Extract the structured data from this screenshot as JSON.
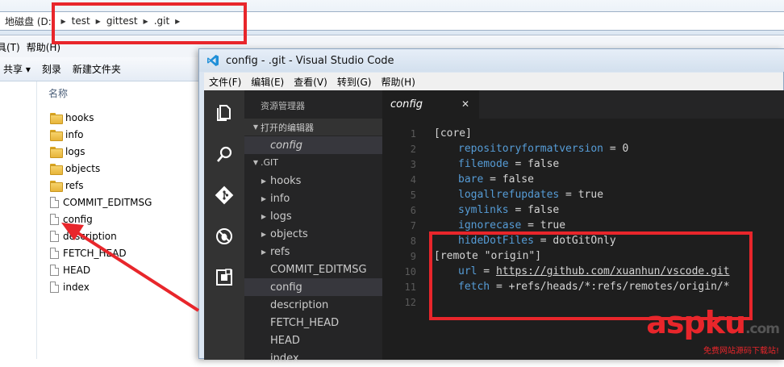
{
  "explorer": {
    "breadcrumb": [
      "地磁盘 (D:)",
      "test",
      "gittest",
      ".git"
    ],
    "menu": [
      "具(T)",
      "帮助(H)"
    ],
    "toolbar": [
      "共享 ▾",
      "刻录",
      "新建文件夹"
    ],
    "column_header": "名称",
    "items": [
      {
        "name": "hooks",
        "type": "folder"
      },
      {
        "name": "info",
        "type": "folder"
      },
      {
        "name": "logs",
        "type": "folder"
      },
      {
        "name": "objects",
        "type": "folder"
      },
      {
        "name": "refs",
        "type": "folder"
      },
      {
        "name": "COMMIT_EDITMSG",
        "type": "file"
      },
      {
        "name": "config",
        "type": "file"
      },
      {
        "name": "description",
        "type": "file"
      },
      {
        "name": "FETCH_HEAD",
        "type": "file"
      },
      {
        "name": "HEAD",
        "type": "file"
      },
      {
        "name": "index",
        "type": "file"
      }
    ]
  },
  "vscode": {
    "title": "config - .git - Visual Studio Code",
    "menu": [
      "文件(F)",
      "编辑(E)",
      "查看(V)",
      "转到(G)",
      "帮助(H)"
    ],
    "activity_icons": [
      "files-icon",
      "search-icon",
      "git-icon",
      "debug-icon",
      "extensions-icon"
    ],
    "sidebar": {
      "title": "资源管理器",
      "open_editors_label": "打开的编辑器",
      "open_editors": [
        "config"
      ],
      "folder_label": ".GIT",
      "tree": [
        {
          "name": "hooks",
          "folder": true
        },
        {
          "name": "info",
          "folder": true
        },
        {
          "name": "logs",
          "folder": true
        },
        {
          "name": "objects",
          "folder": true
        },
        {
          "name": "refs",
          "folder": true
        },
        {
          "name": "COMMIT_EDITMSG",
          "folder": false
        },
        {
          "name": "config",
          "folder": false,
          "selected": true
        },
        {
          "name": "description",
          "folder": false
        },
        {
          "name": "FETCH_HEAD",
          "folder": false
        },
        {
          "name": "HEAD",
          "folder": false
        },
        {
          "name": "index",
          "folder": false
        }
      ]
    },
    "tab": {
      "label": "config",
      "close": "✕"
    },
    "code": [
      {
        "n": "1",
        "indent": 0,
        "key": "[core]",
        "op": "",
        "val": ""
      },
      {
        "n": "2",
        "indent": 1,
        "key": "repositoryformatversion",
        "op": " = ",
        "val": "0"
      },
      {
        "n": "3",
        "indent": 1,
        "key": "filemode",
        "op": " = ",
        "val": "false"
      },
      {
        "n": "4",
        "indent": 1,
        "key": "bare",
        "op": " = ",
        "val": "false"
      },
      {
        "n": "5",
        "indent": 1,
        "key": "logallrefupdates",
        "op": " = ",
        "val": "true"
      },
      {
        "n": "6",
        "indent": 1,
        "key": "symlinks",
        "op": " = ",
        "val": "false"
      },
      {
        "n": "7",
        "indent": 1,
        "key": "ignorecase",
        "op": " = ",
        "val": "true"
      },
      {
        "n": "8",
        "indent": 1,
        "key": "hideDotFiles",
        "op": " = ",
        "val": "dotGitOnly"
      },
      {
        "n": "9",
        "indent": 0,
        "key": "[remote \"origin\"]",
        "op": "",
        "val": ""
      },
      {
        "n": "10",
        "indent": 1,
        "key": "url",
        "op": " = ",
        "val": "https://github.com/xuanhun/vscode.git"
      },
      {
        "n": "11",
        "indent": 1,
        "key": "fetch",
        "op": " = ",
        "val": "+refs/heads/*:refs/remotes/origin/*"
      },
      {
        "n": "12",
        "indent": 0,
        "key": "",
        "op": "",
        "val": ""
      }
    ]
  },
  "watermark": {
    "brand": "aspku",
    "tld": ".com",
    "slogan": "免费网站源码下载站!"
  },
  "colors": {
    "annotation_red": "#e8262b",
    "editor_bg": "#1e1e1e",
    "keyword_blue": "#569cd6"
  }
}
